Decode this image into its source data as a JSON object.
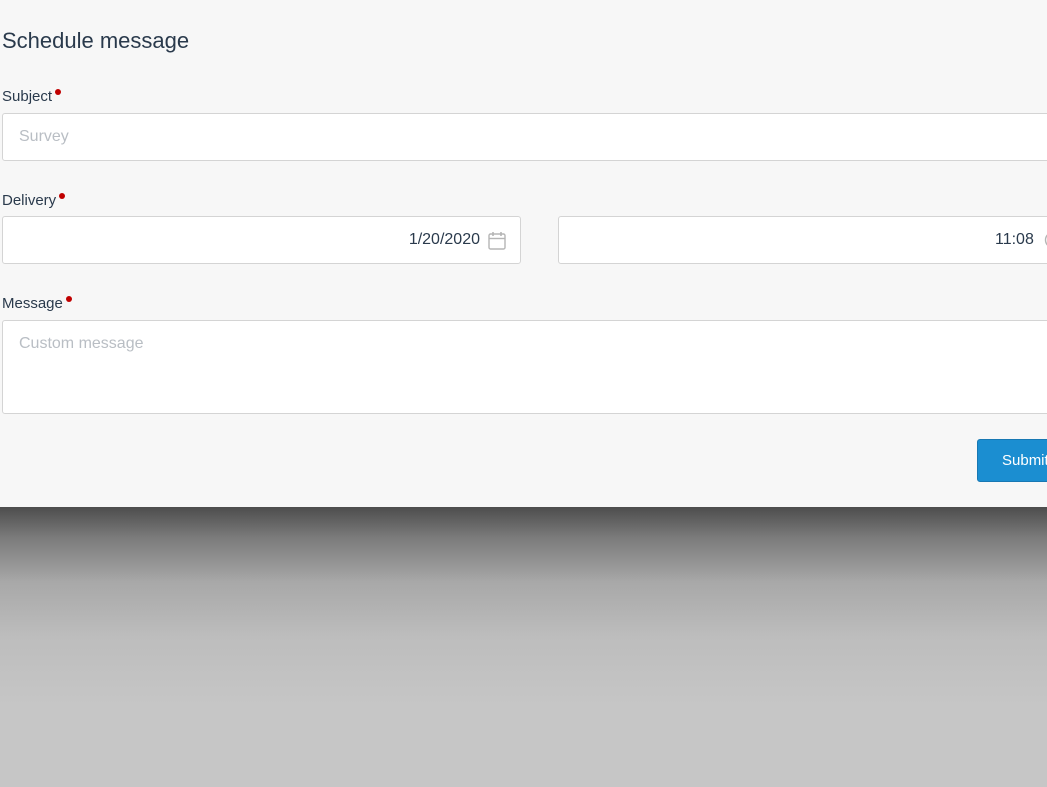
{
  "dialog": {
    "title": "Schedule message"
  },
  "subject": {
    "label": "Subject",
    "placeholder": "Survey",
    "value": ""
  },
  "delivery": {
    "label": "Delivery",
    "date": "1/20/2020",
    "time": "11:08",
    "date_icon": "calendar-icon",
    "time_icon": "clock-icon"
  },
  "message": {
    "label": "Message",
    "placeholder": "Custom message",
    "value": ""
  },
  "actions": {
    "submit_label": "Submit"
  },
  "colors": {
    "required_marker": "#c00000",
    "primary_button": "#1b8ed1",
    "text": "#2a3a4c",
    "placeholder": "#b9bec4",
    "panel_background": "#f7f7f7",
    "overlay_background": "#c6c6c6"
  }
}
